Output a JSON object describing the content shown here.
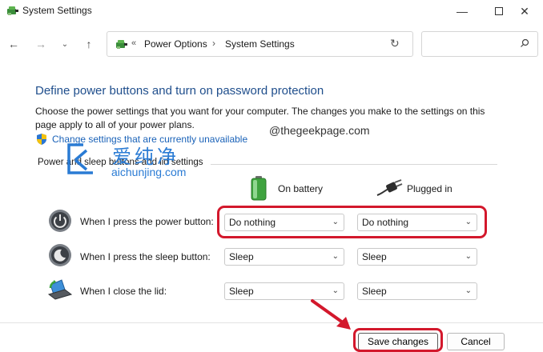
{
  "window": {
    "title": "System Settings",
    "controls": {
      "minimize": "—",
      "maximize": "☐",
      "close": "✕"
    }
  },
  "nav": {
    "back": "←",
    "forward": "→",
    "recent": "⌄",
    "up": "↑",
    "breadcrumb_overflow": "«",
    "breadcrumbs": [
      "Power Options",
      "System Settings"
    ],
    "separator": "›",
    "refresh": "↻",
    "search_icon": "⚲",
    "search_placeholder": ""
  },
  "content": {
    "heading": "Define power buttons and turn on password protection",
    "description": "Choose the power settings that you want for your computer. The changes you make to the settings on this page apply to all of your power plans.",
    "change_link": "Change settings that are currently unavailable",
    "section_title": "Power and sleep buttons and lid settings"
  },
  "watermark": {
    "site": "@thegeekpage.com",
    "logo_text": "爱纯净",
    "logo_url": "aichunjing.com"
  },
  "columns": {
    "battery": {
      "label": "On battery",
      "icon": "battery-icon"
    },
    "plugged": {
      "label": "Plugged in",
      "icon": "plug-icon"
    }
  },
  "rows": [
    {
      "label": "When I press the power button:",
      "icon": "power-button-icon",
      "battery": "Do nothing",
      "plugged": "Do nothing"
    },
    {
      "label": "When I press the sleep button:",
      "icon": "sleep-button-icon",
      "battery": "Sleep",
      "plugged": "Sleep"
    },
    {
      "label": "When I close the lid:",
      "icon": "laptop-lid-icon",
      "battery": "Sleep",
      "plugged": "Sleep"
    }
  ],
  "dropdown_chevron": "⌄",
  "footer": {
    "save": "Save changes",
    "cancel": "Cancel"
  },
  "colors": {
    "heading": "#1f4e8c",
    "link": "#1a62b8",
    "highlight": "#d3182c",
    "watermark": "#2a7bd4"
  }
}
